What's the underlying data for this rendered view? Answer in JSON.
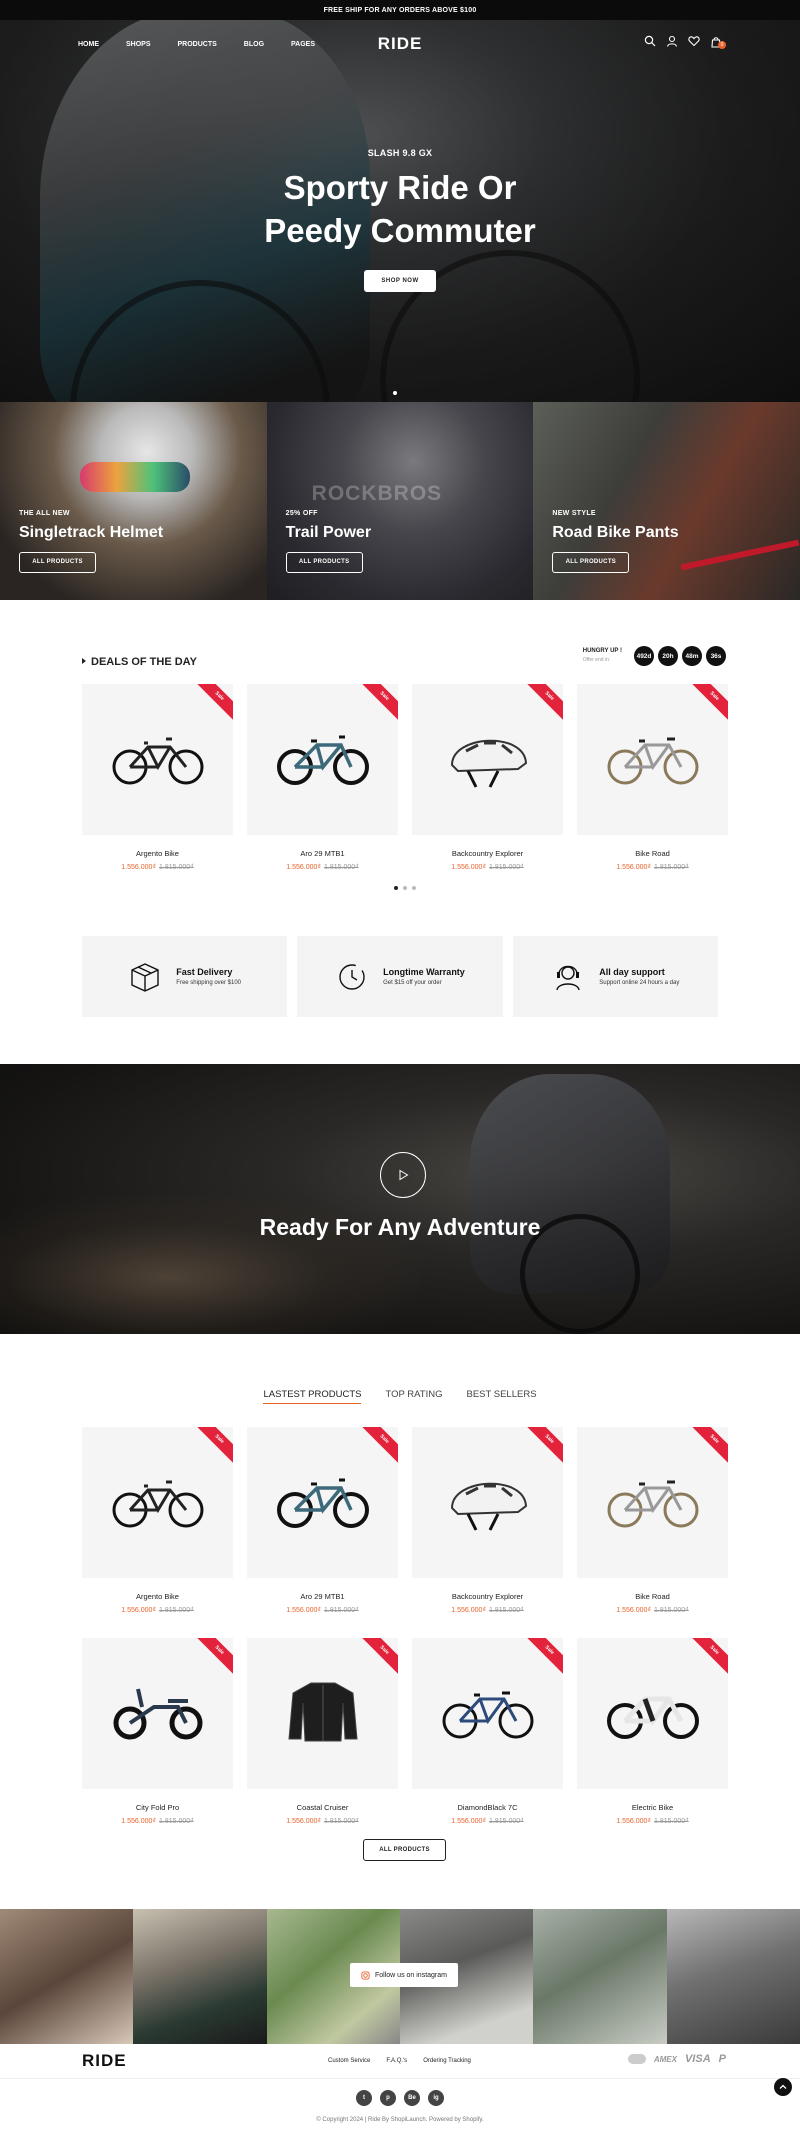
{
  "topbar": {
    "text": "FREE SHIP FOR ANY ORDERS ABOVE $100"
  },
  "nav": {
    "links": [
      "HOME",
      "SHOPS",
      "PRODUCTS",
      "BLOG",
      "PAGES"
    ],
    "logo": "RIDE",
    "cart_count": "0"
  },
  "hero": {
    "kicker": "SLASH 9.8 GX",
    "title_line1": "Sporty Ride Or",
    "title_line2": "Peedy Commuter",
    "button": "SHOP NOW"
  },
  "banners": [
    {
      "small": "THE ALL NEW",
      "big": "Singletrack Helmet",
      "button": "ALL PRODUCTS"
    },
    {
      "small": "25% OFF",
      "big": "Trail Power",
      "button": "ALL PRODUCTS",
      "brand_text": "ROCKBROS"
    },
    {
      "small": "NEW STYLE",
      "big": "Road Bike Pants",
      "button": "ALL PRODUCTS"
    }
  ],
  "deals": {
    "title": "DEALS OF THE DAY",
    "countdown_label": "HUNGRY UP !",
    "countdown_sub": "Offer end in:",
    "countdown": [
      "492d",
      "20h",
      "48m",
      "36s"
    ],
    "sale_label": "Sale",
    "products": [
      {
        "name": "Argento Bike",
        "price": "1.556.000₫",
        "old_price": "1.815.000₫"
      },
      {
        "name": "Aro 29 MTB1",
        "price": "1.556.000₫",
        "old_price": "1.815.000₫"
      },
      {
        "name": "Backcountry Explorer",
        "price": "1.556.000₫",
        "old_price": "1.815.000₫"
      },
      {
        "name": "Bike Road",
        "price": "1.556.000₫",
        "old_price": "1.815.000₫"
      }
    ]
  },
  "features": [
    {
      "title": "Fast Delivery",
      "sub": "Free shipping over $100",
      "icon": "box-icon"
    },
    {
      "title": "Longtime Warranty",
      "sub": "Get $15 off your order",
      "icon": "clock-icon"
    },
    {
      "title": "All day support",
      "sub": "Support online 24 hours a day",
      "icon": "headset-icon"
    }
  ],
  "video": {
    "title": "Ready For Any Adventure"
  },
  "tabs": [
    "LASTEST PRODUCTS",
    "TOP RATING",
    "BEST SELLERS"
  ],
  "latest": {
    "products": [
      {
        "name": "Argento Bike",
        "price": "1.556.000₫",
        "old_price": "1.815.000₫"
      },
      {
        "name": "Aro 29 MTB1",
        "price": "1.556.000₫",
        "old_price": "1.815.000₫"
      },
      {
        "name": "Backcountry Explorer",
        "price": "1.556.000₫",
        "old_price": "1.815.000₫"
      },
      {
        "name": "Bike Road",
        "price": "1.556.000₫",
        "old_price": "1.815.000₫"
      },
      {
        "name": "City Fold Pro",
        "price": "1.556.000₫",
        "old_price": "1.815.000₫"
      },
      {
        "name": "Coastal Cruiser",
        "price": "1.556.000₫",
        "old_price": "1.815.000₫"
      },
      {
        "name": "DiamondBlack 7C",
        "price": "1.556.000₫",
        "old_price": "1.815.000₫"
      },
      {
        "name": "Electric Bike",
        "price": "1.556.000₫",
        "old_price": "1.815.000₫"
      }
    ],
    "button": "ALL PRODUCTS"
  },
  "instagram": {
    "button": "Follow us on instagram"
  },
  "footer": {
    "logo": "RIDE",
    "links": [
      "Custom Service",
      "F.A.Q.'s",
      "Ordering Tracking"
    ],
    "payments": [
      "AMEX",
      "VISA",
      "P"
    ],
    "socials": [
      "t",
      "p",
      "Be",
      "ig"
    ],
    "copyright": "© Copyright 2024 | Ride By ShopiLaunch. Powered by Shopify."
  },
  "colors": {
    "accent": "#e8632b",
    "sale": "#e2233b",
    "dark": "#111111"
  }
}
